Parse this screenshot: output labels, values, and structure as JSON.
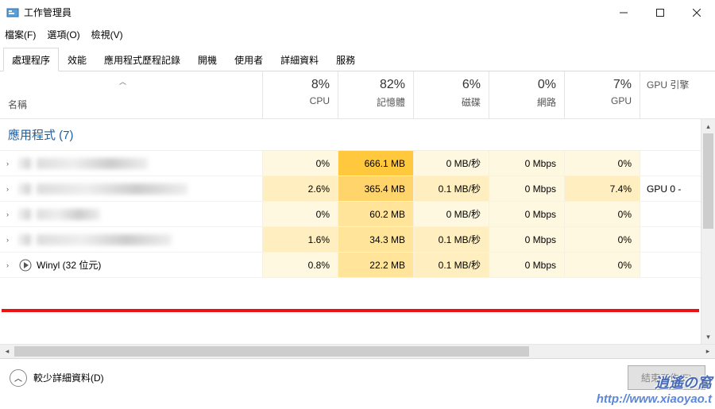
{
  "window": {
    "title": "工作管理員",
    "menu": {
      "file": "檔案(F)",
      "options": "選項(O)",
      "view": "檢視(V)"
    }
  },
  "tabs": [
    "處理程序",
    "效能",
    "應用程式歷程記錄",
    "開機",
    "使用者",
    "詳細資料",
    "服務"
  ],
  "headers": {
    "name": "名稱",
    "cpu": {
      "pct": "8%",
      "label": "CPU"
    },
    "mem": {
      "pct": "82%",
      "label": "記憶體"
    },
    "disk": {
      "pct": "6%",
      "label": "磁碟"
    },
    "net": {
      "pct": "0%",
      "label": "網路"
    },
    "gpu": {
      "pct": "7%",
      "label": "GPU"
    },
    "gpu_engine": "GPU 引擎"
  },
  "group": "應用程式 (7)",
  "rows": [
    {
      "cpu": "0%",
      "mem": "666.1 MB",
      "disk": "0 MB/秒",
      "net": "0 Mbps",
      "gpu": "0%",
      "eng": "",
      "blurred": true,
      "iw": 140
    },
    {
      "cpu": "2.6%",
      "mem": "365.4 MB",
      "disk": "0.1 MB/秒",
      "net": "0 Mbps",
      "gpu": "7.4%",
      "eng": "GPU 0 -",
      "blurred": true,
      "iw": 190
    },
    {
      "cpu": "0%",
      "mem": "60.2 MB",
      "disk": "0 MB/秒",
      "net": "0 Mbps",
      "gpu": "0%",
      "eng": "",
      "blurred": true,
      "iw": 80
    },
    {
      "cpu": "1.6%",
      "mem": "34.3 MB",
      "disk": "0.1 MB/秒",
      "net": "0 Mbps",
      "gpu": "0%",
      "eng": "",
      "blurred": true,
      "iw": 170
    },
    {
      "name": "Winyl (32 位元)",
      "cpu": "0.8%",
      "mem": "22.2 MB",
      "disk": "0.1 MB/秒",
      "net": "0 Mbps",
      "gpu": "0%",
      "eng": "",
      "blurred": false
    }
  ],
  "footer": {
    "fewer": "較少詳細資料(D)",
    "end": "結束工作(E)"
  },
  "watermark": {
    "top": "逍遙の窩",
    "url": "http://www.xiaoyao.t"
  },
  "heat": {
    "cpu": [
      "heat-0",
      "heat-1",
      "heat-0",
      "heat-1",
      "heat-0"
    ],
    "mem": [
      "heat-4",
      "heat-3",
      "heat-2",
      "heat-2",
      "heat-2"
    ],
    "disk": [
      "heat-0",
      "heat-1",
      "heat-0",
      "heat-1",
      "heat-1"
    ],
    "net": [
      "heat-0",
      "heat-0",
      "heat-0",
      "heat-0",
      "heat-0"
    ],
    "gpu": [
      "heat-0",
      "heat-1",
      "heat-0",
      "heat-0",
      "heat-0"
    ]
  }
}
